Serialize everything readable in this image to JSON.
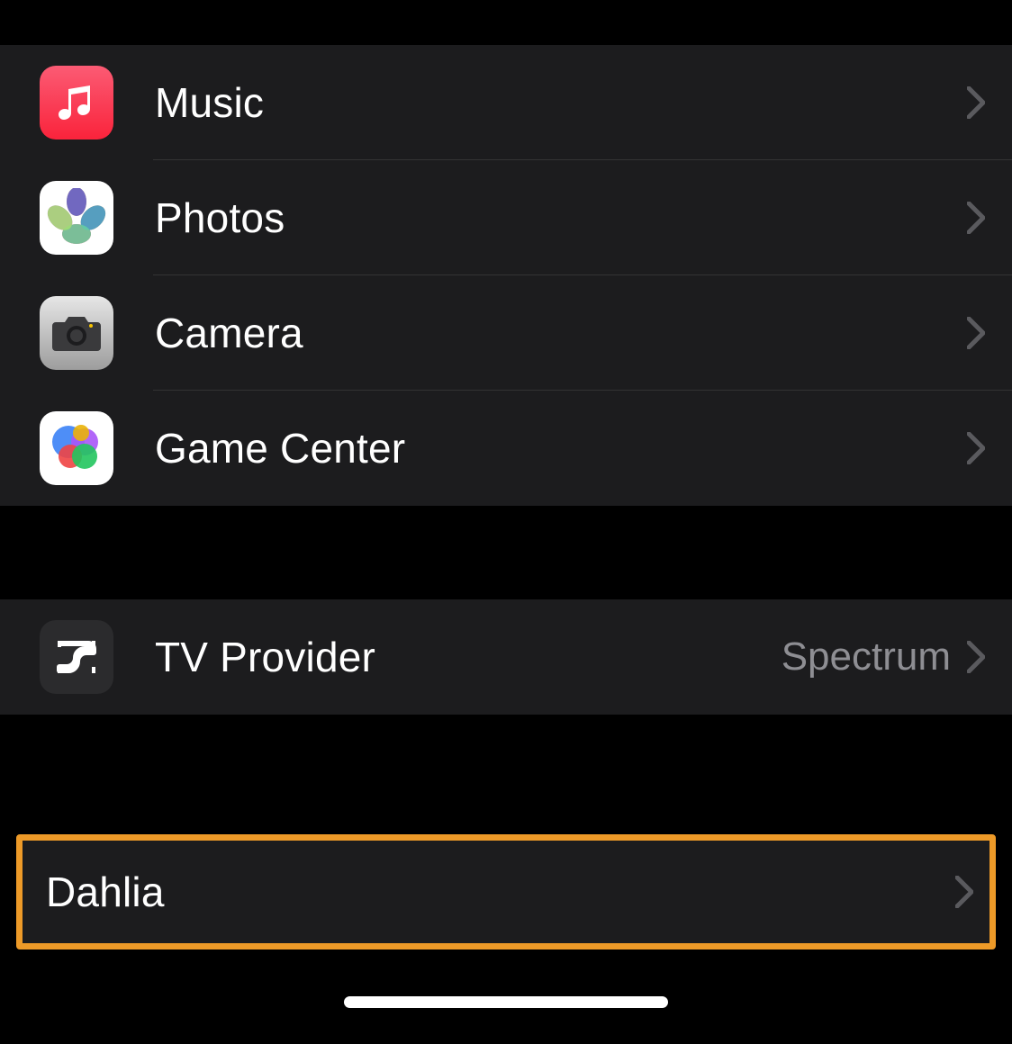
{
  "group1": {
    "items": [
      {
        "name": "music",
        "label": "Music",
        "icon": "music-icon"
      },
      {
        "name": "photos",
        "label": "Photos",
        "icon": "photos-icon"
      },
      {
        "name": "camera",
        "label": "Camera",
        "icon": "camera-icon"
      },
      {
        "name": "gamecenter",
        "label": "Game Center",
        "icon": "gamecenter-icon"
      }
    ]
  },
  "group2": {
    "items": [
      {
        "name": "tvprovider",
        "label": "TV Provider",
        "value": "Spectrum",
        "icon": "tvprovider-icon"
      }
    ]
  },
  "group3": {
    "items": [
      {
        "name": "dahlia",
        "label": "Dahlia"
      }
    ]
  }
}
